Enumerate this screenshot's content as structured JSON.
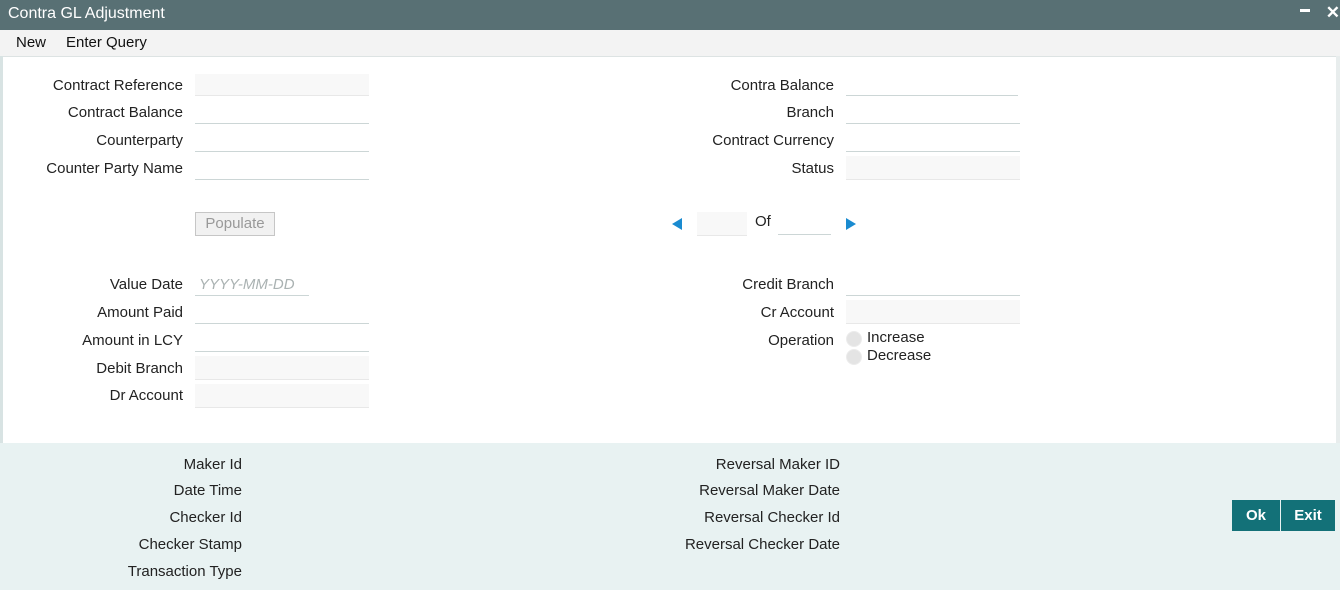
{
  "window": {
    "title": "Contra GL Adjustment",
    "minimize_glyph": "–",
    "close_glyph": "✕"
  },
  "menu": {
    "new_label": "New",
    "enter_query_label": "Enter Query"
  },
  "left_fields": {
    "contract_reference": "Contract Reference",
    "contract_balance": "Contract Balance",
    "counterparty": "Counterparty",
    "counter_party_name": "Counter Party Name"
  },
  "right_fields": {
    "contra_balance": "Contra Balance",
    "branch": "Branch",
    "contract_currency": "Contract Currency",
    "status": "Status"
  },
  "populate_label": "Populate",
  "pager": {
    "of_label": "Of",
    "current": "",
    "total": ""
  },
  "detail_left": {
    "value_date": "Value Date",
    "value_date_placeholder": "YYYY-MM-DD",
    "amount_paid": "Amount Paid",
    "amount_in_lcy": "Amount in LCY",
    "debit_branch": "Debit Branch",
    "dr_account": "Dr Account"
  },
  "detail_right": {
    "credit_branch": "Credit Branch",
    "cr_account": "Cr Account",
    "operation": "Operation",
    "increase": "Increase",
    "decrease": "Decrease"
  },
  "audit_left": {
    "maker_id": "Maker Id",
    "date_time": "Date Time",
    "checker_id": "Checker Id",
    "checker_stamp": "Checker Stamp",
    "transaction_type": "Transaction Type"
  },
  "audit_right": {
    "reversal_maker_id": "Reversal Maker ID",
    "reversal_maker_date": "Reversal Maker Date",
    "reversal_checker_id": "Reversal Checker Id",
    "reversal_checker_date": "Reversal Checker Date"
  },
  "buttons": {
    "ok": "Ok",
    "exit": "Exit"
  },
  "colors": {
    "titlebar": "#587074",
    "footer": "#e8f2f2",
    "button": "#137178",
    "arrow": "#1a8bd0"
  }
}
